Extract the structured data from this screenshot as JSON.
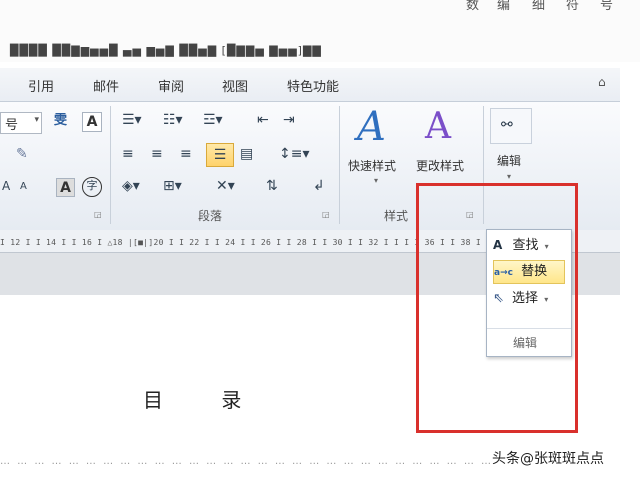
{
  "top_chars": [
    "数",
    "编",
    "细",
    "符",
    "号"
  ],
  "window_title": "████ ██▇▆▅▅█ ▄▅  ▆▅▇ ██▅▇ [█▇▇▅ ▇▅▅]▇▇",
  "tabs": [
    "引用",
    "邮件",
    "审阅",
    "视图",
    "特色功能"
  ],
  "font_group": {
    "size_label": "号",
    "wen_label": "雯",
    "a_box": "A",
    "a_small_up": "A",
    "a_small_down": "A",
    "a_bold": "A",
    "enclosed": "字"
  },
  "paragraph_group": {
    "label": "段落"
  },
  "styles_group": {
    "label": "样式",
    "quick_styles": "快速样式",
    "change_styles": "更改样式"
  },
  "editing_group": {
    "label": "编辑"
  },
  "ruler_text": "I 12 I  I 14 I  I 16 I  △18 |[■|]20 I  I 22 I  I 24 I  I 26 I  I 28 I  I 30 I  I 32 I  I  I  I 36 I  I 38 I",
  "dropdown": {
    "find": "查找",
    "replace": "替换",
    "select": "选择",
    "group_label": "编辑",
    "find_icon_text": "A",
    "replace_icon_text": "a→c"
  },
  "document": {
    "toc_title": "目 录"
  },
  "dot_leader": "… … … … … … … … … … … … … … … … … … … … … … … … … … … … …",
  "watermark": "头条@张斑斑点点",
  "colors": {
    "highlight_box": "#d9302c",
    "accent_blue": "#2f6fbf",
    "accent_purple": "#7b4fc9"
  }
}
